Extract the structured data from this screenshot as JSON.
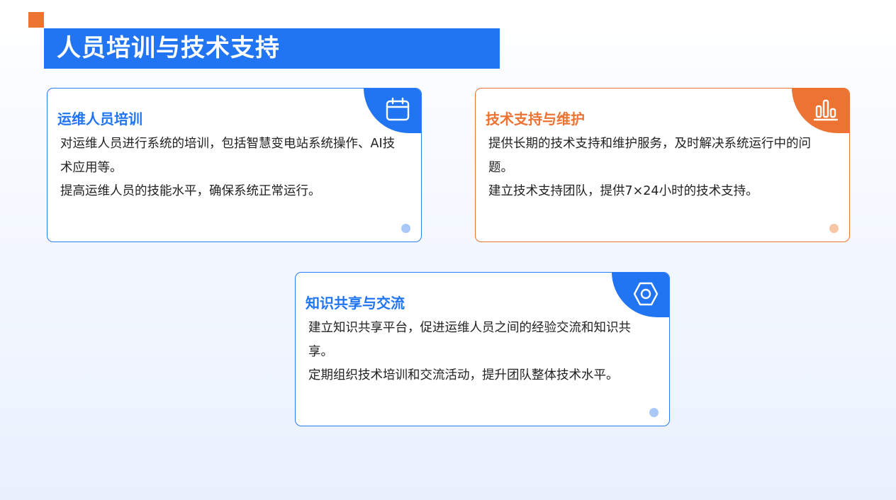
{
  "page": {
    "title": "人员培训与技术支持",
    "accent_blue": "#2175f3",
    "accent_orange": "#ec7332"
  },
  "cards": [
    {
      "title": "运维人员培训",
      "icon": "calendar-icon",
      "color": "blue",
      "lines": [
        "对运维人员进行系统的培训，包括智慧变电站系统操作、AI技术应用等。",
        "提高运维人员的技能水平，确保系统正常运行。"
      ]
    },
    {
      "title": "技术支持与维护",
      "icon": "bar-chart-icon",
      "color": "orange",
      "lines": [
        "提供长期的技术支持和维护服务，及时解决系统运行中的问题。",
        "建立技术支持团队，提供7×24小时的技术支持。"
      ]
    },
    {
      "title": "知识共享与交流",
      "icon": "hexagon-nut-icon",
      "color": "blue",
      "lines": [
        "建立知识共享平台，促进运维人员之间的经验交流和知识共享。",
        "定期组织技术培训和交流活动，提升团队整体技术水平。"
      ]
    }
  ]
}
